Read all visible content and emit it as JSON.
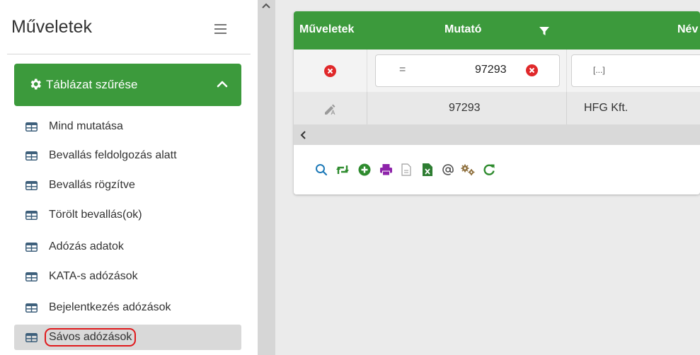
{
  "sidebar": {
    "title": "Műveletek",
    "filter_panel": {
      "label": "Táblázat szűrése"
    },
    "items": [
      {
        "label": "Mind mutatása"
      },
      {
        "label": "Bevallás feldolgozás alatt"
      },
      {
        "label": "Bevallás rögzítve"
      },
      {
        "label": "Törölt bevallás(ok)"
      },
      {
        "label": "Adózás adatok"
      },
      {
        "label": "KATA-s adózások"
      },
      {
        "label": "Bejelentkezés adózások"
      },
      {
        "label": "Sávos adózások",
        "active": true
      }
    ]
  },
  "grid": {
    "columns": [
      "Műveletek",
      "Mutató",
      "Név"
    ],
    "filter_row": {
      "mutato_operator": "=",
      "mutato_value": "97293",
      "nev_placeholder": "[...]"
    },
    "rows": [
      {
        "mutato": "97293",
        "nev": "HFG Kft."
      }
    ]
  },
  "toolbar": {
    "icons": [
      "search-icon",
      "swap-icon",
      "add-icon",
      "print-icon",
      "document-icon",
      "excel-icon",
      "email-icon",
      "settings-icon",
      "refresh-icon"
    ]
  },
  "colors": {
    "accent_green": "#3c9a3c",
    "danger_red": "#e0191c",
    "print_purple": "#8e24aa",
    "toolbar_blue": "#1e7ab8"
  }
}
